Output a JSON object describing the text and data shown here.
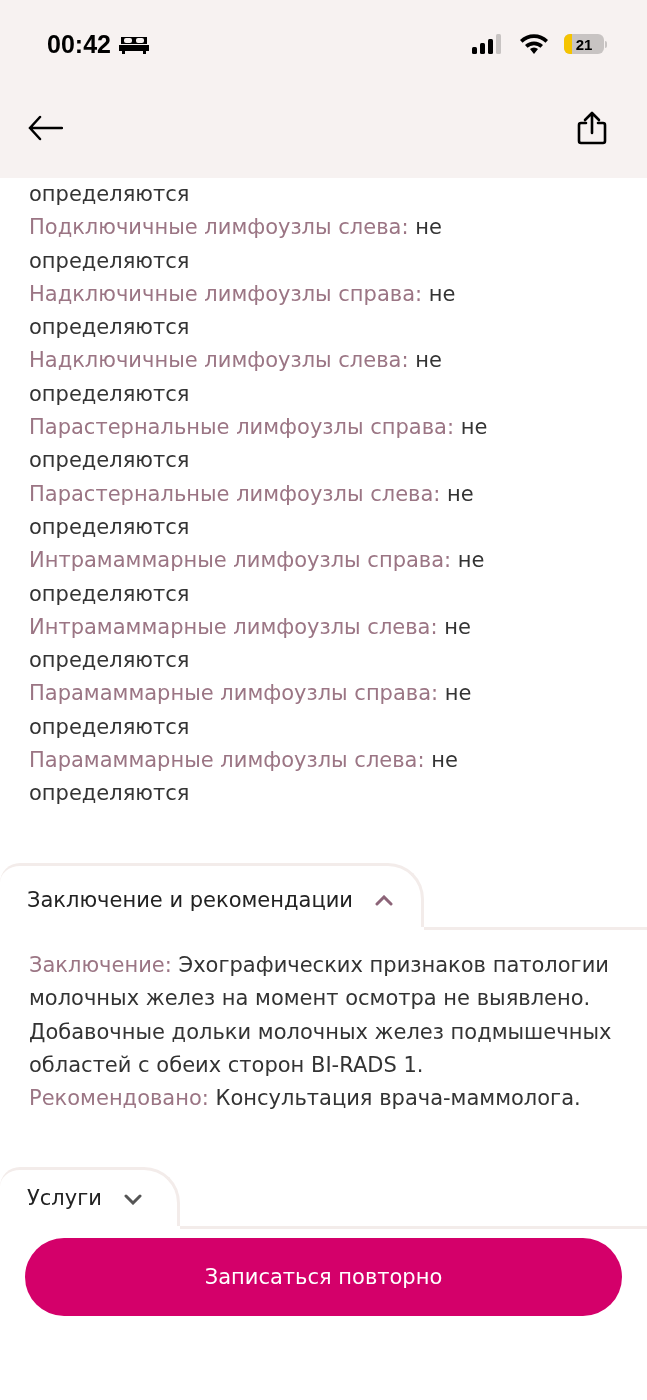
{
  "status_bar": {
    "time": "00:42",
    "battery": "21"
  },
  "findings": [
    {
      "value": "определяются"
    },
    {
      "label": "Подключичные лимфоузлы слева:",
      "value": "не определяются"
    },
    {
      "label": "Надключичные лимфоузлы справа:",
      "value": "не определяются"
    },
    {
      "label": "Надключичные лимфоузлы слева:",
      "value": "не определяются"
    },
    {
      "label": "Парастернальные лимфоузлы справа:",
      "value": "не определяются"
    },
    {
      "label": "Парастернальные лимфоузлы слева:",
      "value": "не определяются"
    },
    {
      "label": "Интрамаммарные лимфоузлы справа:",
      "value": "не определяются"
    },
    {
      "label": "Интрамаммарные лимфоузлы слева:",
      "value": "не определяются"
    },
    {
      "label": "Парамаммарные лимфоузлы справа:",
      "value": "не определяются"
    },
    {
      "label": "Парамаммарные лимфоузлы слева:",
      "value": "не определяются"
    }
  ],
  "sections": [
    {
      "title": "Заключение и рекомендации",
      "expanded": true,
      "fields": [
        {
          "label": "Заключение:",
          "value": "Эхографических признаков патологии молочных желез на момент осмотра не выявлено.  Добавочные дольки молочных желез подмышечных областей с обеих сторон BI-RADS 1."
        },
        {
          "label": "Рекомендовано:",
          "value": "Консультация врача-маммолога."
        }
      ]
    },
    {
      "title": "Услуги",
      "expanded": false
    }
  ],
  "action_button": "Записаться повторно"
}
